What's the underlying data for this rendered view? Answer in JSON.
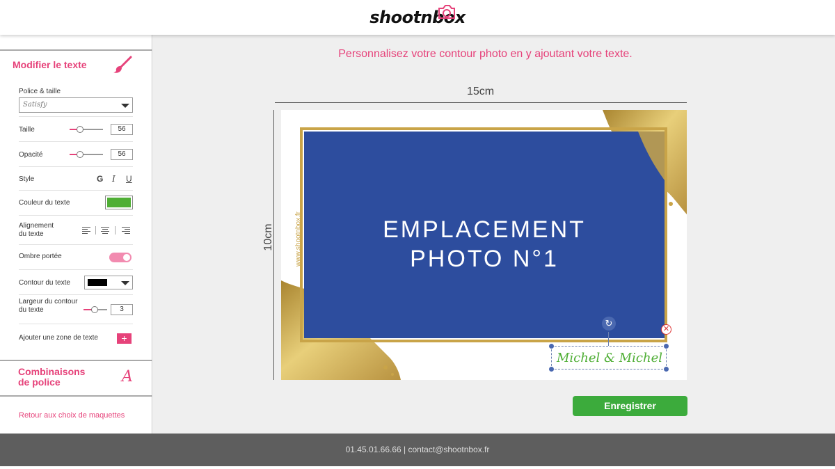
{
  "header": {
    "logo": "shootnbox"
  },
  "sidebar": {
    "title": "Modifier le texte",
    "font_label": "Police & taille",
    "font_value": "Satisfy",
    "size_label": "Taille",
    "size_value": "56",
    "opacity_label": "Opacité",
    "opacity_value": "56",
    "style_label": "Style",
    "style_bold": "G",
    "style_italic": "I",
    "style_underline": "U",
    "color_label": "Couleur du texte",
    "color_value": "#4fae35",
    "align_label_1": "Alignement",
    "align_label_2": "du texte",
    "shadow_label": "Ombre portée",
    "shadow_on": true,
    "outline_label": "Contour du texte",
    "outline_color": "#000000",
    "outline_width_label_1": "Largeur du contour",
    "outline_width_label_2": "du texte",
    "outline_width_value": "3",
    "add_zone_label": "Ajouter une zone de texte",
    "add_zone_button": "+",
    "combo_title_1": "Combinaisons",
    "combo_title_2": "de police",
    "combo_icon": "A",
    "back_link": "Retour aux choix de maquettes"
  },
  "main": {
    "instruction": "Personnalisez votre contour photo en y ajoutant votre texte.",
    "width_label": "15cm",
    "height_label": "10cm",
    "photo_line_1": "EMPLACEMENT",
    "photo_line_2": "PHOTO N°1",
    "vertical_url": "www.shootnbox.fr",
    "text_element": "Michel & Michel",
    "save_button": "Enregistrer"
  },
  "footer": {
    "contact": "01.45.01.66.66 | contact@shootnbox.fr"
  },
  "colors": {
    "accent": "#e6427a",
    "photo_blue": "#2d4d9e",
    "gold": "#c9a448",
    "save_green": "#3cab3c",
    "footer_bg": "#5e5e5e"
  }
}
